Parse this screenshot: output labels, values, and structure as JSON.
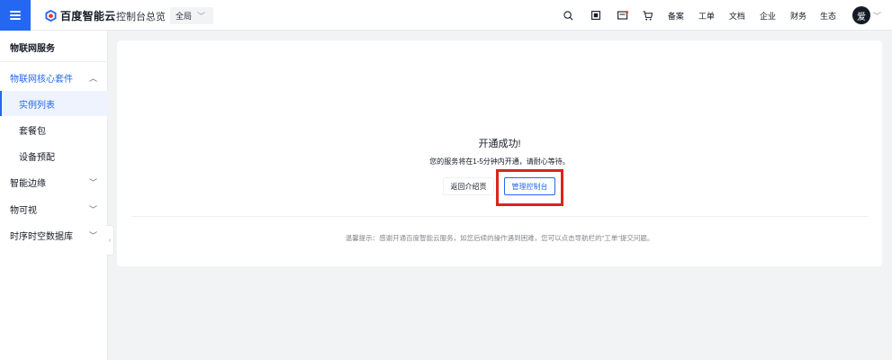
{
  "header": {
    "logo_text": "百度智能云",
    "console_link": "控制台总览",
    "scope_select": "全局",
    "nav_items": [
      {
        "key": "search",
        "icon": "search-icon"
      },
      {
        "key": "apps",
        "icon": "apps-icon"
      },
      {
        "key": "messages",
        "icon": "message-icon"
      },
      {
        "key": "cart",
        "icon": "cart-icon"
      }
    ],
    "links": {
      "filing": "备案",
      "ticket": "工单",
      "docs": "文档",
      "enterprise": "企业",
      "finance": "财务",
      "ecosystem": "生态"
    },
    "avatar_text": "爱"
  },
  "sidebar": {
    "title": "物联网服务",
    "items": [
      {
        "label": "物联网核心套件",
        "arrow": "^"
      },
      {
        "label": "实例列表"
      },
      {
        "label": "套餐包"
      },
      {
        "label": "设备预配"
      },
      {
        "label": "智能边缘",
        "arrow": "v"
      },
      {
        "label": "物可视",
        "arrow": "v"
      },
      {
        "label": "时序时空数据库",
        "arrow": "v"
      }
    ],
    "collapse_glyph": "‹"
  },
  "main": {
    "success_title": "开通成功!",
    "success_desc": "您的服务将在1-5分钟内开通，请耐心等待。",
    "back_button": "返回介绍页",
    "console_button": "管理控制台",
    "tip": "温馨提示：感谢开通百度智能云服务，如您后续的操作遇到困难，您可以点击导航栏的\"工单\"提交问题。"
  },
  "colors": {
    "brand_blue": "#2468f2",
    "highlight_red": "#d9251c"
  }
}
